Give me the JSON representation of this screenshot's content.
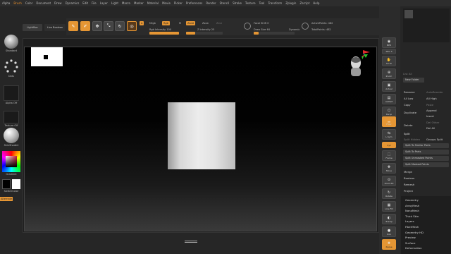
{
  "menu": [
    "Alpha",
    "Brush",
    "Color",
    "Document",
    "Draw",
    "Dynamics",
    "Edit",
    "File",
    "Layer",
    "Light",
    "Macro",
    "Marker",
    "Material",
    "Movie",
    "Picker",
    "Preferences",
    "Render",
    "Stencil",
    "Stroke",
    "Texture",
    "Tool",
    "Transform",
    "Zplugin",
    "Zscript",
    "Help"
  ],
  "menu_active": "Brush",
  "lightrow": {
    "lightbox": "LightBox",
    "live_boolean": "Live Boolean"
  },
  "toolbar": {
    "edit": "Edit",
    "draw": "Draw",
    "move": "Move",
    "scale": "Scale",
    "rotate": "Rotate",
    "a_label": "A",
    "mrgb": "Mrgb",
    "rgb": "Rgb",
    "m": "M",
    "zadd": "Zadd",
    "zsub": "Zsub",
    "zcut": "Zcut",
    "rgb_intensity_label": "Rgb Intensity",
    "rgb_intensity_value": "100",
    "z_intensity_label": "Z Intensity",
    "z_intensity_value": "25",
    "focal_shift_label": "Focal Shift",
    "focal_shift_value": "0",
    "draw_size_label": "Draw Size",
    "draw_size_value": "64",
    "dynamic": "Dynamic",
    "active_points": "ActivePoints: 482",
    "total_points": "TotalPoints: 482"
  },
  "leftshelf": {
    "standard": "Standard",
    "dots": "Dots",
    "alpha_off": "Alpha Off",
    "texture_off": "Texture Off",
    "material": "SkinShade4",
    "gradient": "Gradient",
    "switchcolor": "SwitchColor",
    "alternate": "Alternate"
  },
  "rshelf": {
    "bpr": "BPR",
    "spix": "SPix 3",
    "scroll": "Scroll",
    "zoom": "Zoom",
    "actual": "Actual",
    "aahalf": "AAHalf",
    "persp": "Persp",
    "floor": "Floor",
    "lsym": "L.Sym",
    "xyz": "Xyz",
    "frame": "Frame",
    "move": "Move",
    "zoom3d": "Zoom3D",
    "rotate": "Rotate",
    "linefill": "Line Fill",
    "polyf": "PolyF",
    "transp": "Transp",
    "ghost": "Ghost",
    "dynamic": "Dynamic",
    "solo": "Solo",
    "xpose": "Xpose"
  },
  "subtool": {
    "list_all": "List All",
    "new_folder": "New Folder",
    "rename": "Rename",
    "autoreorder": "AutoReorder",
    "all_low": "All Low",
    "all_high": "All High",
    "copy": "Copy",
    "paste": "Paste",
    "duplicate": "Duplicate",
    "append": "Append",
    "insert": "Insert",
    "delete": "Delete",
    "del_other": "Del Other",
    "del_all": "Del All",
    "split": "Split",
    "split_hidden": "Split Hidden",
    "groups_split": "Groups Split",
    "split_similar": "Split To Similar Parts",
    "split_parts": "Split To Parts",
    "split_unmasked": "Split Unmasked Points",
    "split_masked": "Split Masked Points",
    "merge": "Merge",
    "boolean": "Boolean",
    "remesh": "Remesh",
    "project": "Project",
    "extract": "Extract"
  },
  "subpanels": [
    "Geometry",
    "ArrayMesh",
    "NanoMesh",
    "Thick Skin",
    "Layers",
    "FiberMesh",
    "Geometry HD",
    "Preview",
    "Surface",
    "Deformation"
  ],
  "colors": {
    "accent": "#e59634",
    "bg": "#262626",
    "viewport_top": "#000000",
    "viewport_bottom": "#3a3a3a"
  }
}
